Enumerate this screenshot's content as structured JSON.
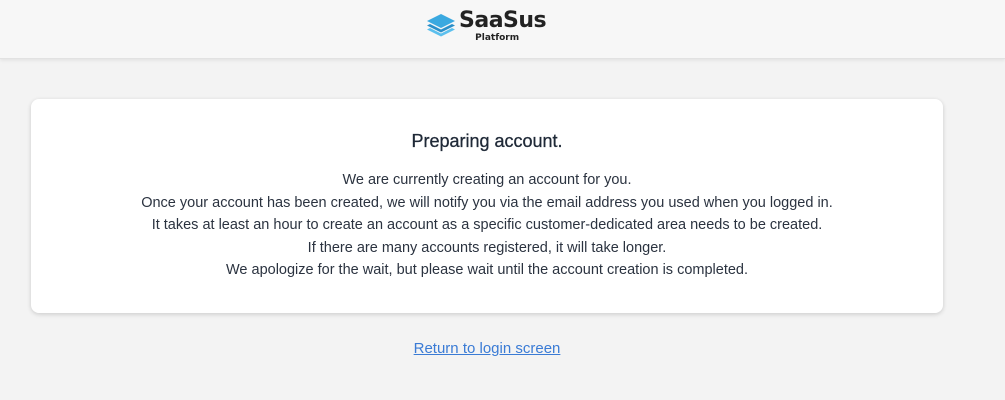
{
  "header": {
    "logo_name": "SaaSus",
    "logo_sub": "Platform",
    "logo_icon": "stacked-layers-icon",
    "brand_color": "#3ba9e0"
  },
  "card": {
    "title": "Preparing account.",
    "lines": [
      "We are currently creating an account for you.",
      "Once your account has been created, we will notify you via the email address you used when you logged in.",
      "It takes at least an hour to create an account as a specific customer-dedicated area needs to be created.",
      "If there are many accounts registered, it will take longer.",
      "We apologize for the wait, but please wait until the account creation is completed."
    ]
  },
  "footer": {
    "return_link": "Return to login screen",
    "link_color": "#3a7bd5"
  }
}
